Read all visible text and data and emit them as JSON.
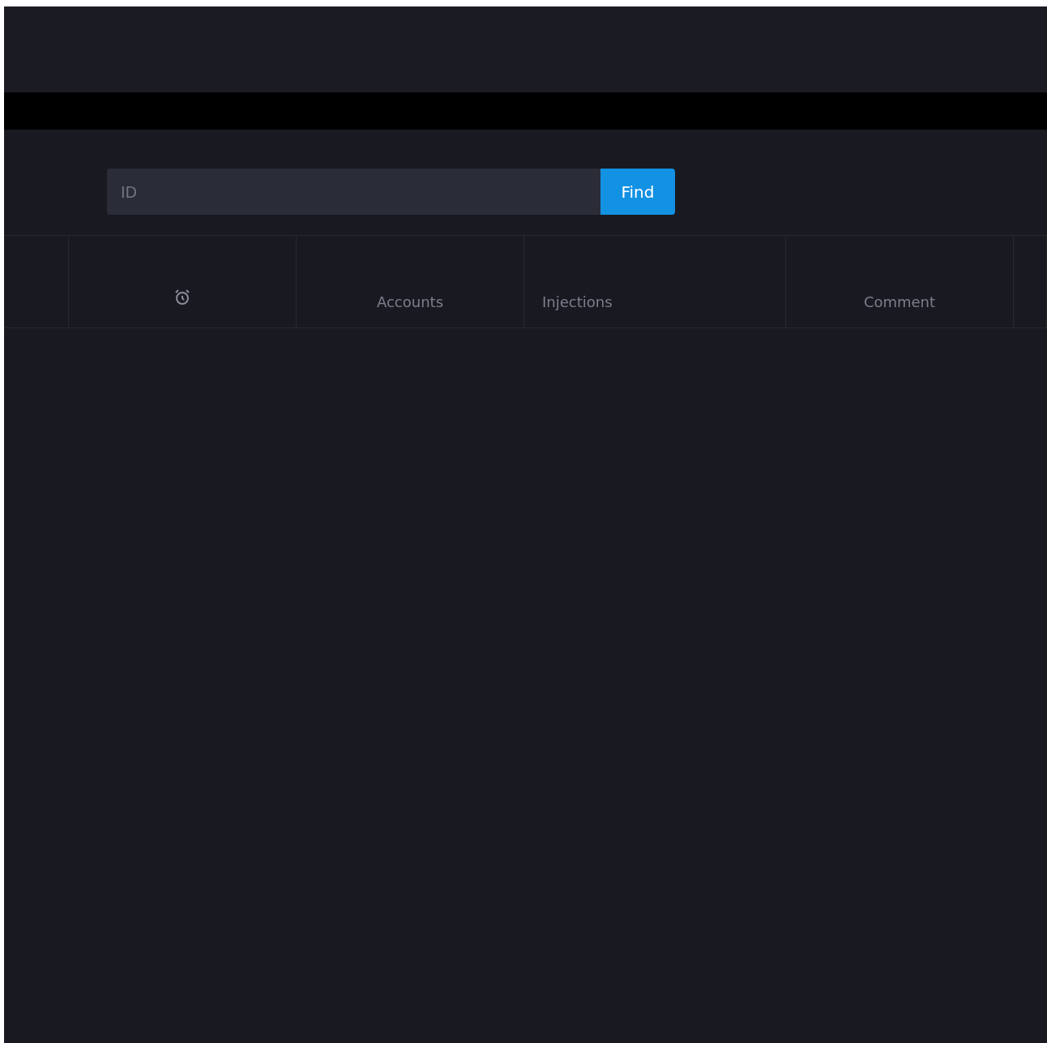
{
  "search": {
    "placeholder": "ID",
    "button": "Find"
  },
  "table": {
    "columns": [
      {
        "kind": "blank"
      },
      {
        "kind": "icon"
      },
      {
        "kind": "text",
        "label": "Accounts"
      },
      {
        "kind": "text",
        "label": "Injections"
      },
      {
        "kind": "text",
        "label": "Comment"
      },
      {
        "kind": "blank"
      }
    ]
  }
}
